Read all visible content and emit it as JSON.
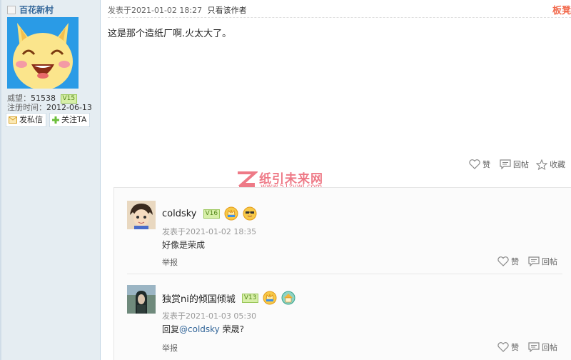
{
  "user": {
    "name": "百花新村",
    "prestige_label": "威望：",
    "prestige_value": "51538",
    "level": "V15",
    "register_label": "注册时间：",
    "register_date": "2012-06-13",
    "message_button": "发私信",
    "follow_button": "关注TA"
  },
  "post": {
    "meta": "发表于2021-01-02 18:27",
    "only_author": "只看该作者",
    "board_link": "板凳",
    "content": "这是那个造纸厂啊.火太大了。",
    "actions": {
      "like": "赞",
      "reply": "回帖",
      "favorite": "收藏"
    }
  },
  "watermark": {
    "title": "纸引未来网",
    "url": "www.51zywl.com"
  },
  "comments": [
    {
      "name": "coldsky",
      "level": "V16",
      "time": "发表于2021-01-02 18:35",
      "text": "好像是荣成",
      "report": "举报",
      "like": "赞",
      "reply": "回帖"
    },
    {
      "name": "独赏ni的倾国倾城",
      "level": "V13",
      "time": "发表于2021-01-03 05:30",
      "text_prefix": "回复",
      "text_mention": "@coldsky",
      "text_suffix": " 荣晟?",
      "report": "举报",
      "like": "赞",
      "reply": "回帖"
    }
  ]
}
